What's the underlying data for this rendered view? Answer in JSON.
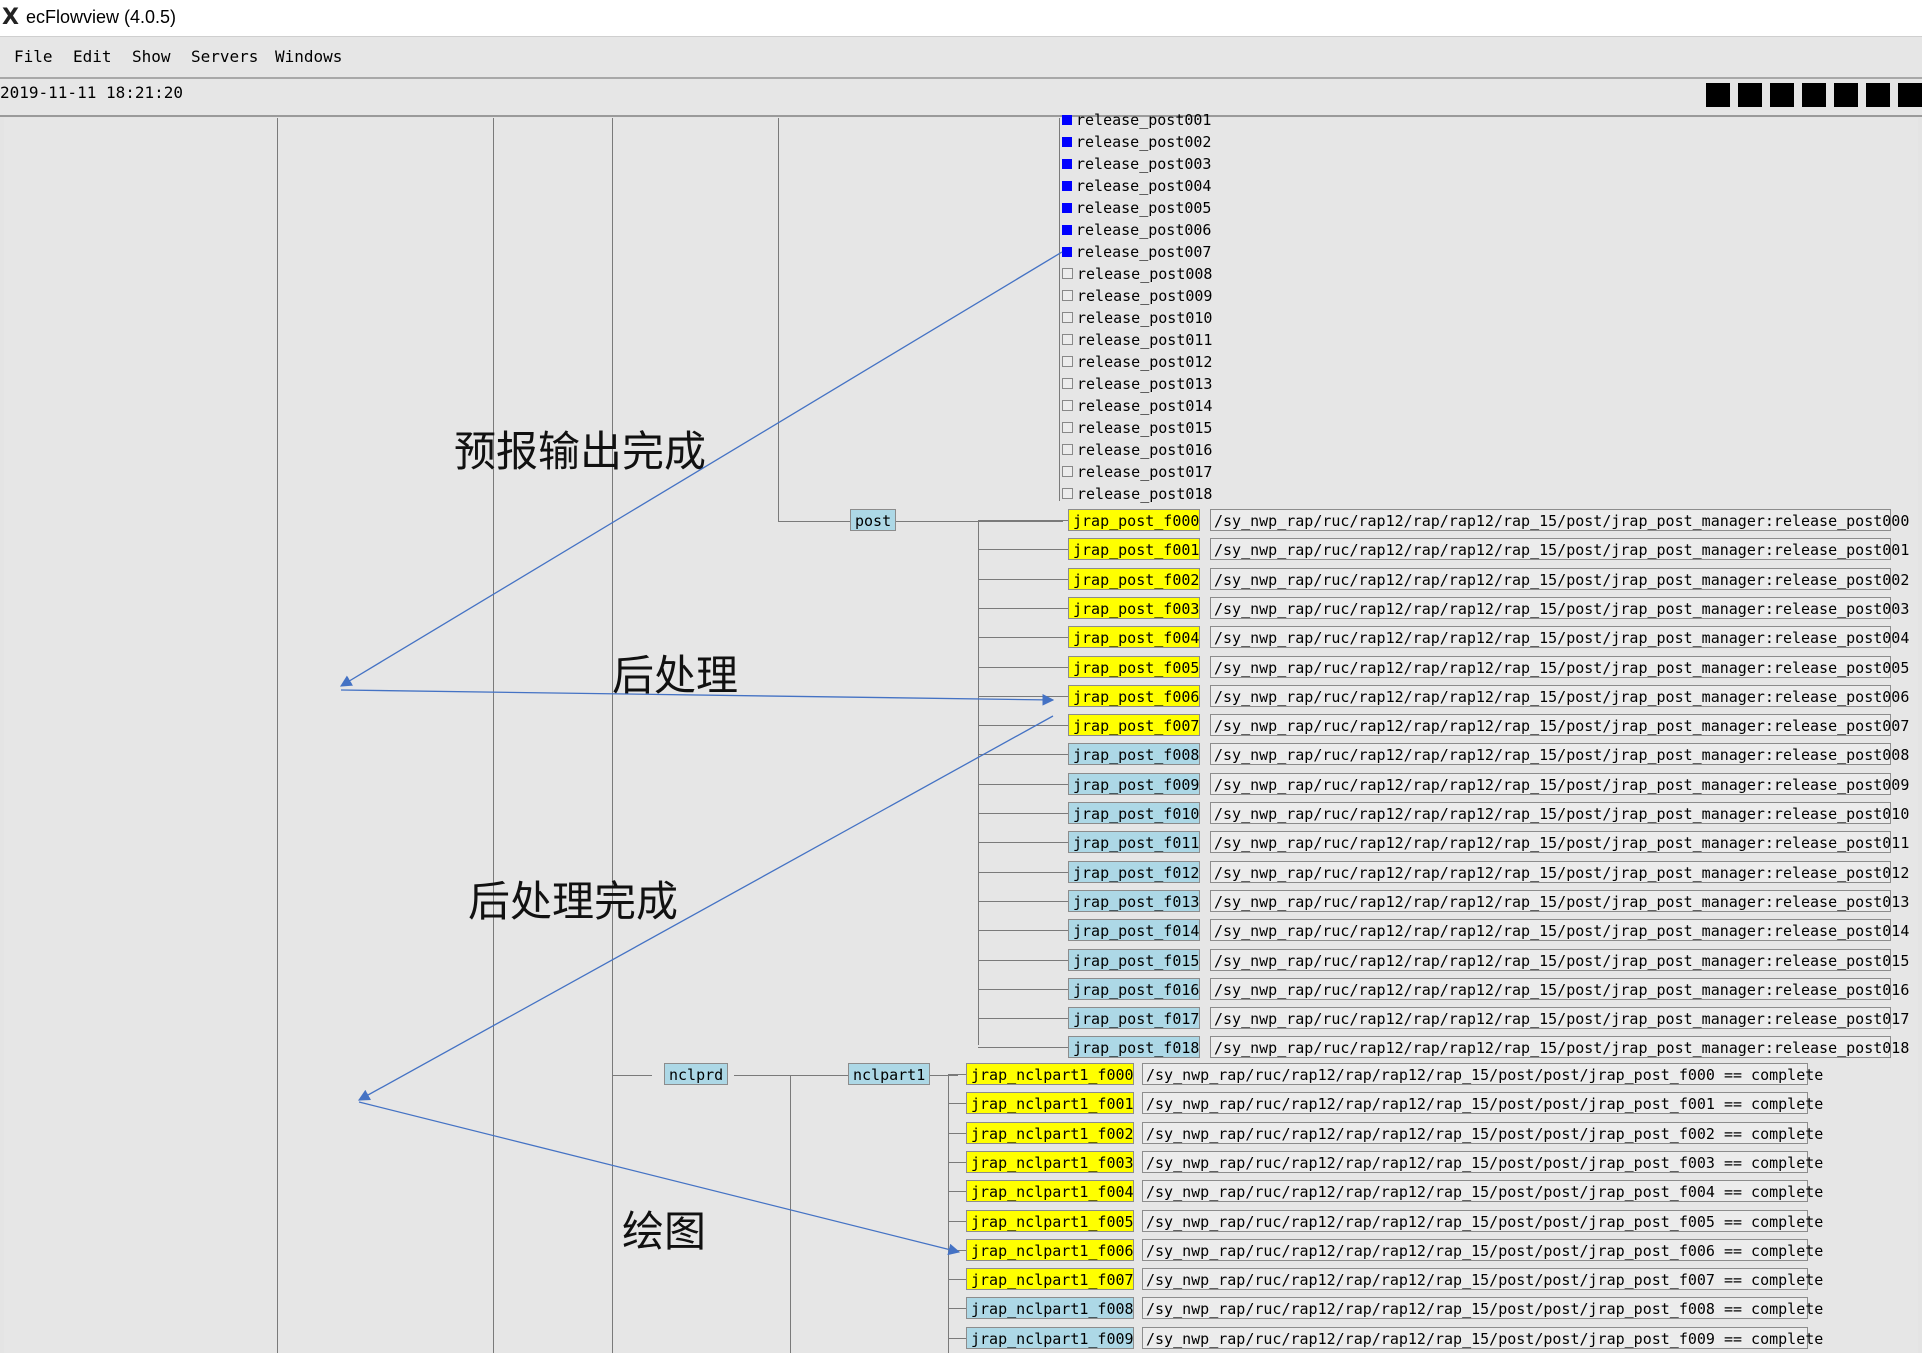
{
  "window": {
    "title": "ecFlowview (4.0.5)",
    "app_icon": "x-window-icon"
  },
  "menubar": {
    "items": [
      "File",
      "Edit",
      "Show",
      "Servers",
      "Windows"
    ]
  },
  "status": {
    "datetime": "2019-11-11 18:21:20",
    "status_blocks": 7
  },
  "release_posts": [
    {
      "label": "release_post001",
      "state": "blue"
    },
    {
      "label": "release_post002",
      "state": "blue"
    },
    {
      "label": "release_post003",
      "state": "blue"
    },
    {
      "label": "release_post004",
      "state": "blue"
    },
    {
      "label": "release_post005",
      "state": "blue"
    },
    {
      "label": "release_post006",
      "state": "blue"
    },
    {
      "label": "release_post007",
      "state": "blue"
    },
    {
      "label": "release_post008",
      "state": "gray"
    },
    {
      "label": "release_post009",
      "state": "gray"
    },
    {
      "label": "release_post010",
      "state": "gray"
    },
    {
      "label": "release_post011",
      "state": "gray"
    },
    {
      "label": "release_post012",
      "state": "gray"
    },
    {
      "label": "release_post013",
      "state": "gray"
    },
    {
      "label": "release_post014",
      "state": "gray"
    },
    {
      "label": "release_post015",
      "state": "gray"
    },
    {
      "label": "release_post016",
      "state": "gray"
    },
    {
      "label": "release_post017",
      "state": "gray"
    },
    {
      "label": "release_post018",
      "state": "gray"
    }
  ],
  "families": {
    "post": "post",
    "nclprd": "nclprd",
    "nclpart1": "nclpart1"
  },
  "post_tasks": [
    {
      "name": "jrap_post_f000",
      "state": "yellow",
      "trigger": "/sy_nwp_rap/ruc/rap12/rap/rap12/rap_15/post/jrap_post_manager:release_post000"
    },
    {
      "name": "jrap_post_f001",
      "state": "yellow",
      "trigger": "/sy_nwp_rap/ruc/rap12/rap/rap12/rap_15/post/jrap_post_manager:release_post001"
    },
    {
      "name": "jrap_post_f002",
      "state": "yellow",
      "trigger": "/sy_nwp_rap/ruc/rap12/rap/rap12/rap_15/post/jrap_post_manager:release_post002"
    },
    {
      "name": "jrap_post_f003",
      "state": "yellow",
      "trigger": "/sy_nwp_rap/ruc/rap12/rap/rap12/rap_15/post/jrap_post_manager:release_post003"
    },
    {
      "name": "jrap_post_f004",
      "state": "yellow",
      "trigger": "/sy_nwp_rap/ruc/rap12/rap/rap12/rap_15/post/jrap_post_manager:release_post004"
    },
    {
      "name": "jrap_post_f005",
      "state": "yellow",
      "trigger": "/sy_nwp_rap/ruc/rap12/rap/rap12/rap_15/post/jrap_post_manager:release_post005"
    },
    {
      "name": "jrap_post_f006",
      "state": "yellow",
      "trigger": "/sy_nwp_rap/ruc/rap12/rap/rap12/rap_15/post/jrap_post_manager:release_post006"
    },
    {
      "name": "jrap_post_f007",
      "state": "yellow",
      "trigger": "/sy_nwp_rap/ruc/rap12/rap/rap12/rap_15/post/jrap_post_manager:release_post007"
    },
    {
      "name": "jrap_post_f008",
      "state": "blue",
      "trigger": "/sy_nwp_rap/ruc/rap12/rap/rap12/rap_15/post/jrap_post_manager:release_post008"
    },
    {
      "name": "jrap_post_f009",
      "state": "blue",
      "trigger": "/sy_nwp_rap/ruc/rap12/rap/rap12/rap_15/post/jrap_post_manager:release_post009"
    },
    {
      "name": "jrap_post_f010",
      "state": "blue",
      "trigger": "/sy_nwp_rap/ruc/rap12/rap/rap12/rap_15/post/jrap_post_manager:release_post010"
    },
    {
      "name": "jrap_post_f011",
      "state": "blue",
      "trigger": "/sy_nwp_rap/ruc/rap12/rap/rap12/rap_15/post/jrap_post_manager:release_post011"
    },
    {
      "name": "jrap_post_f012",
      "state": "blue",
      "trigger": "/sy_nwp_rap/ruc/rap12/rap/rap12/rap_15/post/jrap_post_manager:release_post012"
    },
    {
      "name": "jrap_post_f013",
      "state": "blue",
      "trigger": "/sy_nwp_rap/ruc/rap12/rap/rap12/rap_15/post/jrap_post_manager:release_post013"
    },
    {
      "name": "jrap_post_f014",
      "state": "blue",
      "trigger": "/sy_nwp_rap/ruc/rap12/rap/rap12/rap_15/post/jrap_post_manager:release_post014"
    },
    {
      "name": "jrap_post_f015",
      "state": "blue",
      "trigger": "/sy_nwp_rap/ruc/rap12/rap/rap12/rap_15/post/jrap_post_manager:release_post015"
    },
    {
      "name": "jrap_post_f016",
      "state": "blue",
      "trigger": "/sy_nwp_rap/ruc/rap12/rap/rap12/rap_15/post/jrap_post_manager:release_post016"
    },
    {
      "name": "jrap_post_f017",
      "state": "blue",
      "trigger": "/sy_nwp_rap/ruc/rap12/rap/rap12/rap_15/post/jrap_post_manager:release_post017"
    },
    {
      "name": "jrap_post_f018",
      "state": "blue",
      "trigger": "/sy_nwp_rap/ruc/rap12/rap/rap12/rap_15/post/jrap_post_manager:release_post018"
    }
  ],
  "ncl_tasks": [
    {
      "name": "jrap_nclpart1_f000",
      "state": "yellow",
      "trigger": "/sy_nwp_rap/ruc/rap12/rap/rap12/rap_15/post/post/jrap_post_f000 == complete"
    },
    {
      "name": "jrap_nclpart1_f001",
      "state": "yellow",
      "trigger": "/sy_nwp_rap/ruc/rap12/rap/rap12/rap_15/post/post/jrap_post_f001 == complete"
    },
    {
      "name": "jrap_nclpart1_f002",
      "state": "yellow",
      "trigger": "/sy_nwp_rap/ruc/rap12/rap/rap12/rap_15/post/post/jrap_post_f002 == complete"
    },
    {
      "name": "jrap_nclpart1_f003",
      "state": "yellow",
      "trigger": "/sy_nwp_rap/ruc/rap12/rap/rap12/rap_15/post/post/jrap_post_f003 == complete"
    },
    {
      "name": "jrap_nclpart1_f004",
      "state": "yellow",
      "trigger": "/sy_nwp_rap/ruc/rap12/rap/rap12/rap_15/post/post/jrap_post_f004 == complete"
    },
    {
      "name": "jrap_nclpart1_f005",
      "state": "yellow",
      "trigger": "/sy_nwp_rap/ruc/rap12/rap/rap12/rap_15/post/post/jrap_post_f005 == complete"
    },
    {
      "name": "jrap_nclpart1_f006",
      "state": "yellow",
      "trigger": "/sy_nwp_rap/ruc/rap12/rap/rap12/rap_15/post/post/jrap_post_f006 == complete"
    },
    {
      "name": "jrap_nclpart1_f007",
      "state": "yellow",
      "trigger": "/sy_nwp_rap/ruc/rap12/rap/rap12/rap_15/post/post/jrap_post_f007 == complete"
    },
    {
      "name": "jrap_nclpart1_f008",
      "state": "blue",
      "trigger": "/sy_nwp_rap/ruc/rap12/rap/rap12/rap_15/post/post/jrap_post_f008 == complete"
    },
    {
      "name": "jrap_nclpart1_f009",
      "state": "blue",
      "trigger": "/sy_nwp_rap/ruc/rap12/rap/rap12/rap_15/post/post/jrap_post_f009 == complete"
    }
  ],
  "annotations": {
    "forecast_output_done": "预报输出完成",
    "post_processing": "后处理",
    "post_processing_done": "后处理完成",
    "plotting": "绘图"
  },
  "colors": {
    "queued_yellow": "#ffff00",
    "active_blue": "#add8e6",
    "release_blue": "#0000ff",
    "arrow": "#4472c4"
  }
}
